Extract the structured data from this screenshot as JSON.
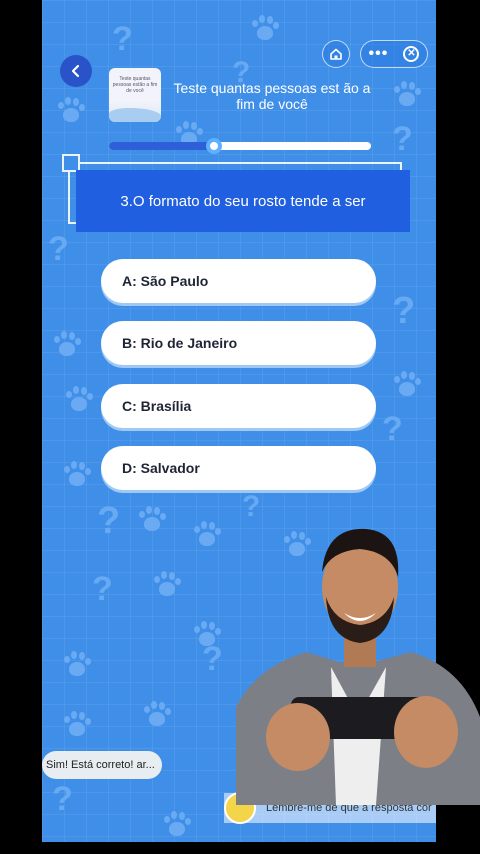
{
  "quiz": {
    "title": "Teste quantas pessoas est ão a fim de você",
    "thumbnail_text": "Teste quantas pessoas estão a fim de você",
    "progress": 0.4,
    "question": "3.O formato do seu rosto tende a ser",
    "options": [
      {
        "label": "A: São Paulo"
      },
      {
        "label": "B: Rio de Janeiro"
      },
      {
        "label": "C: Brasília"
      },
      {
        "label": "D: Salvador"
      }
    ]
  },
  "header": {
    "back_icon": "back-arrow-icon",
    "home_icon": "home-icon",
    "menu_icon": "more-dots-icon",
    "close_icon": "close-circle-icon",
    "menu_dots": "•••",
    "close_glyph": "✕"
  },
  "overlay": {
    "toast_text": "Sim! Está correto! ar...",
    "reminder_text": "Lembre-me de que a resposta cor"
  },
  "colors": {
    "background": "#3f8fe8",
    "question_bg": "#1f5fe0",
    "back_button": "#2a53c9",
    "option_bg": "#ffffff"
  }
}
